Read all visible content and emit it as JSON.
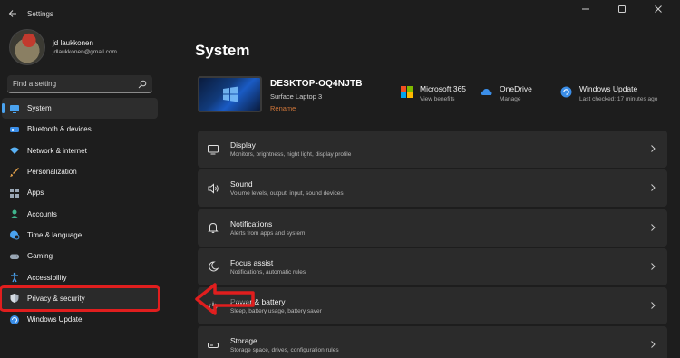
{
  "window": {
    "title": "Settings",
    "back_icon": "back-arrow-icon",
    "controls": [
      "minimize",
      "maximize",
      "close"
    ]
  },
  "profile": {
    "name": "jd laukkonen",
    "email": "jdlaukkonen@gmail.com"
  },
  "search": {
    "placeholder": "Find a setting",
    "icon": "search-icon"
  },
  "sidebar": {
    "items": [
      {
        "label": "System",
        "icon": "monitor-icon",
        "active": true,
        "color": "#4aa3f0"
      },
      {
        "label": "Bluetooth & devices",
        "icon": "bluetooth-icon",
        "color": "#3b8ee8"
      },
      {
        "label": "Network & internet",
        "icon": "wifi-icon",
        "color": "#5ab2f5"
      },
      {
        "label": "Personalization",
        "icon": "brush-icon",
        "color": "#e2a04a"
      },
      {
        "label": "Apps",
        "icon": "apps-icon",
        "color": "#9aa7b5"
      },
      {
        "label": "Accounts",
        "icon": "person-icon",
        "color": "#3fb58c"
      },
      {
        "label": "Time & language",
        "icon": "globe-clock-icon",
        "color": "#4aa3f0"
      },
      {
        "label": "Gaming",
        "icon": "gamepad-icon",
        "color": "#9aa7b5"
      },
      {
        "label": "Accessibility",
        "icon": "accessibility-icon",
        "color": "#4aa3f0"
      },
      {
        "label": "Privacy & security",
        "icon": "shield-icon",
        "highlighted": true,
        "color": "#a9b3bf"
      },
      {
        "label": "Windows Update",
        "icon": "update-icon",
        "color": "#3b8ee8"
      }
    ]
  },
  "main": {
    "title": "System",
    "device": {
      "name": "DESKTOP-OQ4NJTB",
      "model": "Surface Laptop 3",
      "rename_label": "Rename"
    },
    "status_cards": [
      {
        "title": "Microsoft 365",
        "subtitle": "View benefits",
        "icon": "microsoft-365-icon"
      },
      {
        "title": "OneDrive",
        "subtitle": "Manage",
        "icon": "cloud-icon"
      },
      {
        "title": "Windows Update",
        "subtitle": "Last checked: 17 minutes ago",
        "icon": "update-icon"
      }
    ],
    "cards": [
      {
        "title": "Display",
        "subtitle": "Monitors, brightness, night light, display profile",
        "icon": "display-icon"
      },
      {
        "title": "Sound",
        "subtitle": "Volume levels, output, input, sound devices",
        "icon": "speaker-icon"
      },
      {
        "title": "Notifications",
        "subtitle": "Alerts from apps and system",
        "icon": "bell-icon"
      },
      {
        "title": "Focus assist",
        "subtitle": "Notifications, automatic rules",
        "icon": "moon-icon"
      },
      {
        "title": "Power & battery",
        "subtitle": "Sleep, battery usage, battery saver",
        "icon": "power-icon"
      },
      {
        "title": "Storage",
        "subtitle": "Storage space, drives, configuration rules",
        "icon": "storage-icon"
      }
    ]
  },
  "annotation": {
    "color": "#e01e1e",
    "icon": "red-arrow-icon"
  }
}
